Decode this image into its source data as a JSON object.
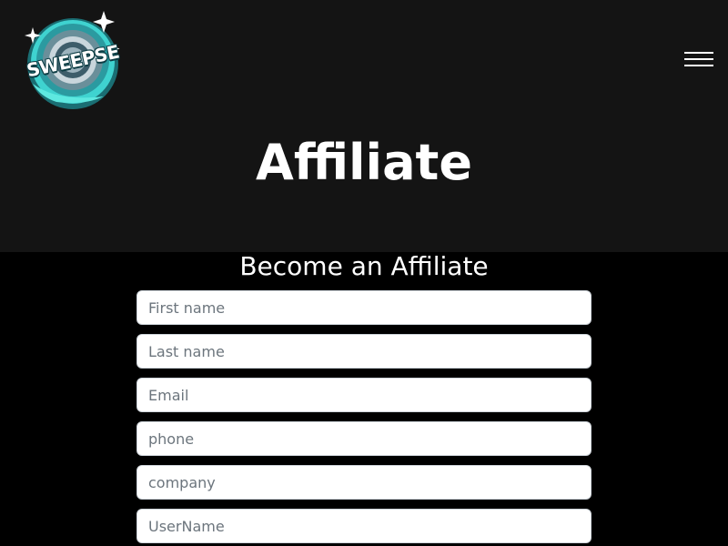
{
  "header": {
    "logo_text": "SWEEPSE",
    "menu_icon": "hamburger-menu-icon",
    "title": "Affiliate"
  },
  "form": {
    "heading": "Become an Affiliate",
    "fields": [
      {
        "placeholder": "First name"
      },
      {
        "placeholder": "Last name"
      },
      {
        "placeholder": "Email"
      },
      {
        "placeholder": "phone"
      },
      {
        "placeholder": "company"
      },
      {
        "placeholder": "UserName"
      }
    ]
  },
  "colors": {
    "hero_background": "#141414",
    "page_background": "#000000",
    "logo_accent": "#3fd3d0"
  }
}
